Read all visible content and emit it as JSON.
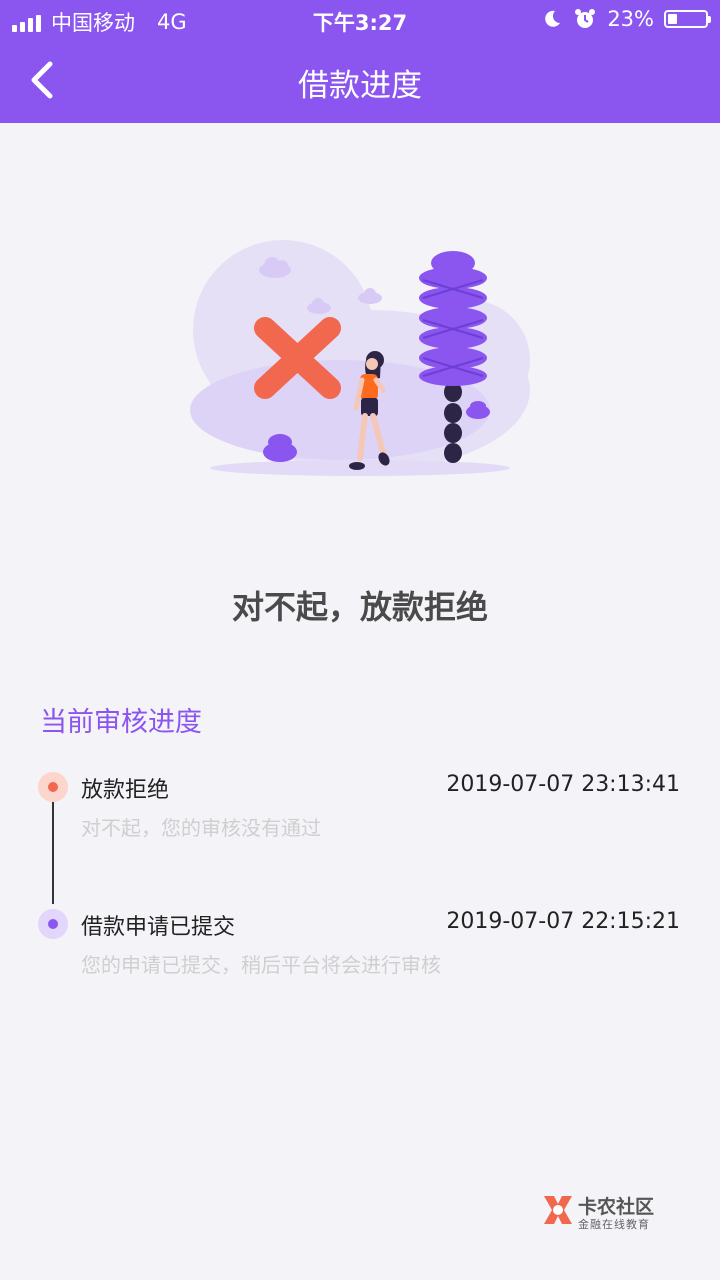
{
  "status_bar": {
    "carrier": "中国移动",
    "network": "4G",
    "time": "下午3:27",
    "battery": "23%"
  },
  "header": {
    "title": "借款进度"
  },
  "result": {
    "title": "对不起，放款拒绝"
  },
  "progress": {
    "section_title": "当前审核进度",
    "items": [
      {
        "label": "放款拒绝",
        "time": "2019-07-07 23:13:41",
        "desc": "对不起，您的审核没有通过",
        "status_color": "#f2684f"
      },
      {
        "label": "借款申请已提交",
        "time": "2019-07-07 22:15:21",
        "desc": "您的申请已提交，稍后平台将会进行审核",
        "status_color": "#8b55f0"
      }
    ]
  },
  "watermark": {
    "name": "卡农社区",
    "sub": "金融在线教育"
  },
  "colors": {
    "accent": "#8b55f0",
    "reject": "#f2684f"
  }
}
